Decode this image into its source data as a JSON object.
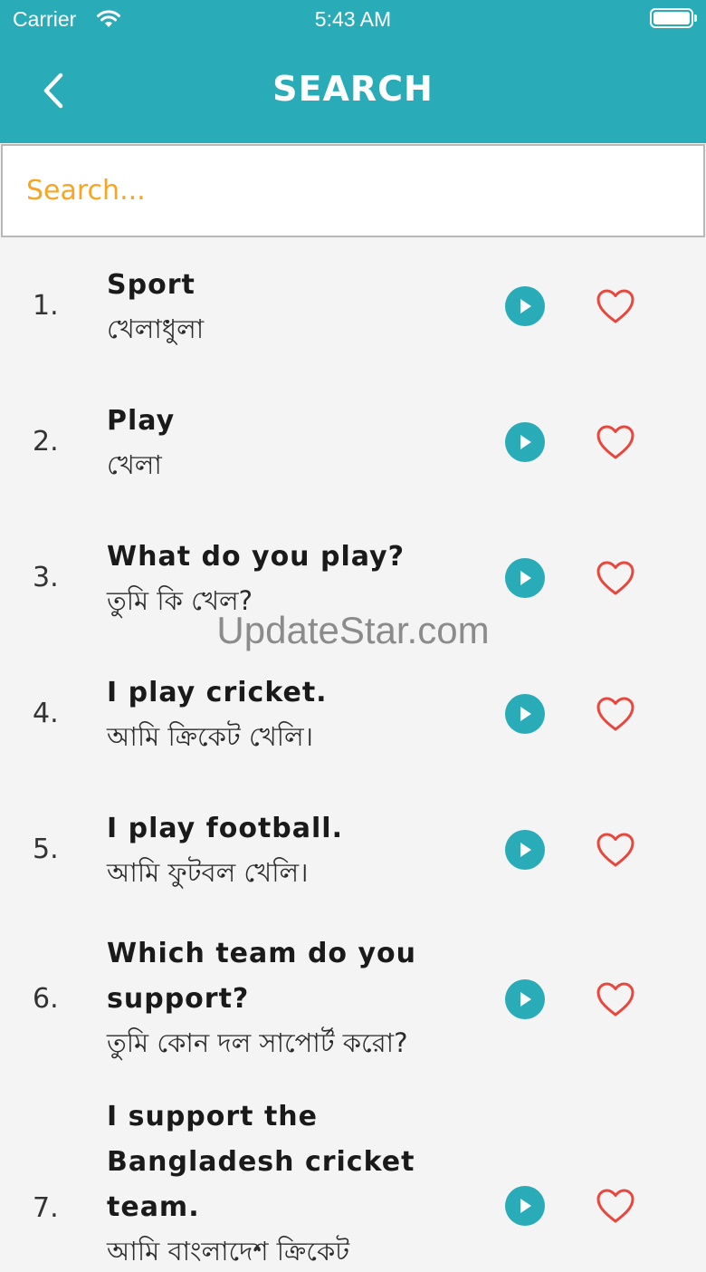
{
  "status_bar": {
    "carrier": "Carrier",
    "time": "5:43 AM"
  },
  "header": {
    "title": "SEARCH",
    "back_icon": "chevron-left-icon"
  },
  "search": {
    "placeholder": "Search...",
    "value": ""
  },
  "colors": {
    "brand": "#2aabb8",
    "placeholder": "#f5a623",
    "heart": "#e8473e"
  },
  "phrases": [
    {
      "number": "1.",
      "english": "Sport",
      "bangla": "খেলাধুলা"
    },
    {
      "number": "2.",
      "english": "Play",
      "bangla": "খেলা"
    },
    {
      "number": "3.",
      "english": "What do you play?",
      "bangla": "তুমি কি খেল?"
    },
    {
      "number": "4.",
      "english": "I play cricket.",
      "bangla": "আমি ক্রিকেট খেলি।"
    },
    {
      "number": "5.",
      "english": "I play football.",
      "bangla": "আমি ফুটবল খেলি।"
    },
    {
      "number": "6.",
      "english": "Which team do you support?",
      "bangla": "তুমি কোন দল সাপোর্ট করো?"
    },
    {
      "number": "7.",
      "english": "I support the Bangladesh cricket team.",
      "bangla": "আমি বাংলাদেশ ক্রিকেট"
    }
  ],
  "watermark": "UpdateStar.com"
}
